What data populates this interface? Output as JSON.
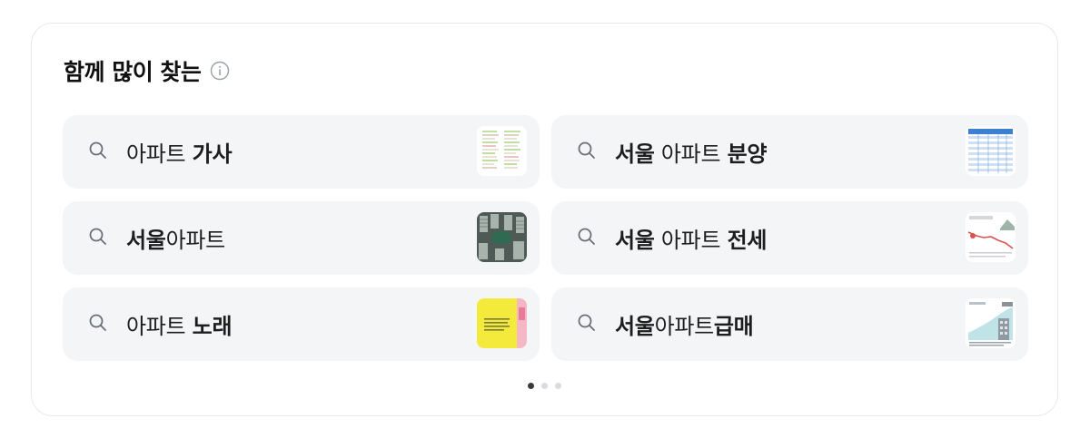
{
  "section": {
    "title": "함께 많이 찾는",
    "info_icon": "info-circle-icon"
  },
  "suggestions": [
    {
      "icon": "search-icon",
      "parts": [
        {
          "text": "아파트 ",
          "bold": false
        },
        {
          "text": "가사",
          "bold": true
        }
      ],
      "thumbnail": "lyrics-document-thumbnail"
    },
    {
      "icon": "search-icon",
      "parts": [
        {
          "text": "서울",
          "bold": true
        },
        {
          "text": " 아파트 ",
          "bold": false
        },
        {
          "text": "분양",
          "bold": true
        }
      ],
      "thumbnail": "table-document-thumbnail"
    },
    {
      "icon": "search-icon",
      "parts": [
        {
          "text": "서울",
          "bold": true
        },
        {
          "text": "아파트",
          "bold": false
        }
      ],
      "thumbnail": "apartment-aerial-thumbnail"
    },
    {
      "icon": "search-icon",
      "parts": [
        {
          "text": "서울",
          "bold": true
        },
        {
          "text": " 아파트 ",
          "bold": false
        },
        {
          "text": "전세",
          "bold": true
        }
      ],
      "thumbnail": "price-chart-thumbnail"
    },
    {
      "icon": "search-icon",
      "parts": [
        {
          "text": "아파트 ",
          "bold": false
        },
        {
          "text": "노래",
          "bold": true
        }
      ],
      "thumbnail": "yellow-poster-thumbnail"
    },
    {
      "icon": "search-icon",
      "parts": [
        {
          "text": "서울",
          "bold": true
        },
        {
          "text": "아파트",
          "bold": false
        },
        {
          "text": "급매",
          "bold": true
        }
      ],
      "thumbnail": "area-chart-thumbnail"
    }
  ],
  "pagination": {
    "total": 3,
    "active": 1
  },
  "colors": {
    "item_bg": "#f4f5f7",
    "dot_active": "#3a3a3a",
    "dot_inactive": "#d9dbe0"
  }
}
